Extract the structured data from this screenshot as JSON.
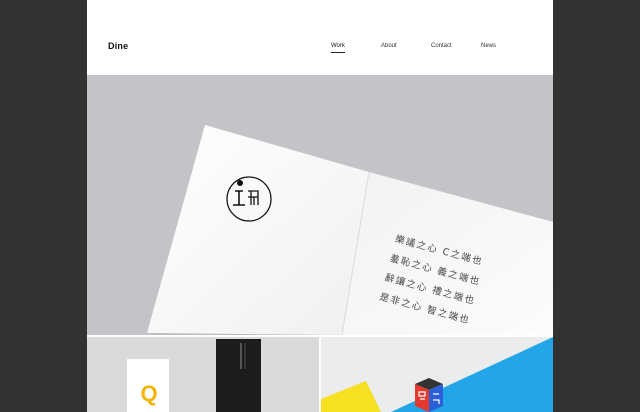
{
  "site": {
    "logo": "Dine"
  },
  "nav": [
    {
      "label": "Work",
      "active": true
    },
    {
      "label": "About",
      "active": false
    },
    {
      "label": "Contact",
      "active": false
    },
    {
      "label": "News",
      "active": false
    }
  ],
  "hero": {
    "text_lines": [
      "樂議之心  C之端也",
      "羞恥之心  義之端也",
      "辭讓之心  禮之端也",
      "是非之心  智之端也"
    ]
  },
  "tiles": {
    "left": {
      "letter": "Q"
    },
    "right": {}
  },
  "colors": {
    "background": "#323232",
    "hero_bg": "#c3c4c7",
    "accent_yellow": "#f5b400",
    "accent_blue": "#22a6e8"
  }
}
